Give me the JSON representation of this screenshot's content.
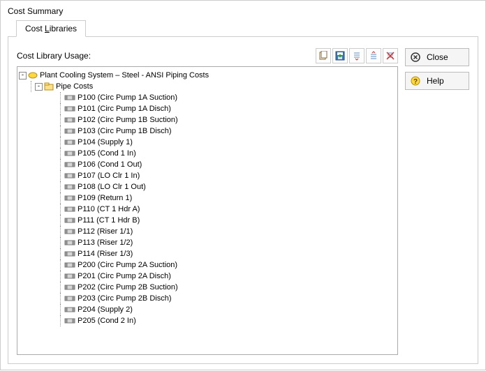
{
  "window": {
    "title": "Cost Summary"
  },
  "tab": {
    "label_pre": "Cost ",
    "label_ul": "L",
    "label_post": "ibraries"
  },
  "usage_label": "Cost Library Usage:",
  "toolbar": {
    "copy": "copy-icon",
    "save": "save-icon",
    "expand": "expand-all-icon",
    "collapse": "collapse-all-icon",
    "clear": "clear-icon"
  },
  "buttons": {
    "close": "Close",
    "help": "Help"
  },
  "tree": {
    "root": {
      "label": "Plant Cooling System – Steel - ANSI Piping Costs"
    },
    "group": {
      "label": "Pipe Costs"
    },
    "items": [
      "P100 (Circ Pump 1A Suction)",
      "P101 (Circ Pump 1A Disch)",
      "P102 (Circ Pump 1B Suction)",
      "P103 (Circ Pump 1B Disch)",
      "P104 (Supply 1)",
      "P105 (Cond 1 In)",
      "P106 (Cond 1 Out)",
      "P107 (LO Clr 1 In)",
      "P108 (LO Clr 1 Out)",
      "P109 (Return 1)",
      "P110 (CT 1 Hdr A)",
      "P111 (CT 1 Hdr B)",
      "P112 (Riser 1/1)",
      "P113 (Riser 1/2)",
      "P114 (Riser 1/3)",
      "P200 (Circ Pump 2A Suction)",
      "P201 (Circ Pump 2A Disch)",
      "P202 (Circ Pump 2B Suction)",
      "P203 (Circ Pump 2B Disch)",
      "P204 (Supply 2)",
      "P205 (Cond 2 In)"
    ]
  }
}
